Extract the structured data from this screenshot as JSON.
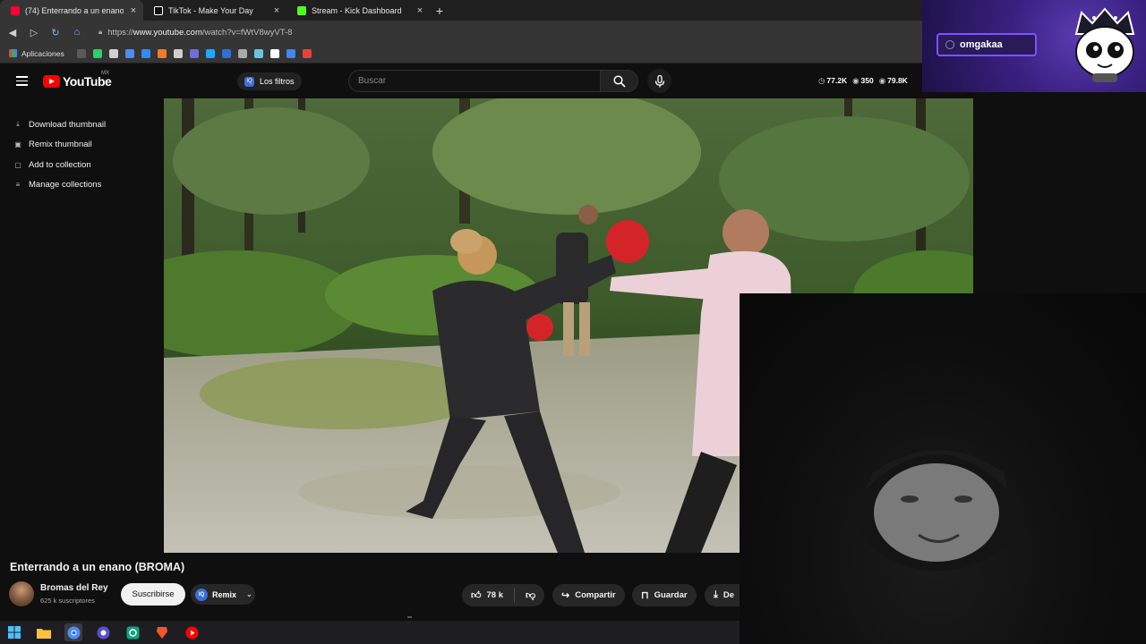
{
  "browser": {
    "tabs": [
      {
        "title": "(74) Enterrando a un enano",
        "favicon_color": "#ff0033",
        "active": true
      },
      {
        "title": "TikTok - Make Your Day",
        "favicon_color": "#ffffff",
        "active": false
      },
      {
        "title": "Stream - Kick Dashboard",
        "favicon_color": "#53fc18",
        "active": false
      }
    ],
    "new_tab_glyph": "+",
    "url_prefix": "https://",
    "url_host": "www.youtube.com",
    "url_path": "/watch?v=fWtV8wyVT-8",
    "bookmarks_label": "Aplicaciones",
    "bookmark_icon_colors": [
      "#5a5a5a",
      "#25d366",
      "#d0d0d0",
      "#4a8df6",
      "#2d8cff",
      "#f07b2a",
      "#cfcfcf",
      "#6f6fd8",
      "#1ea7fd",
      "#2f6fd6",
      "#aaaaaa",
      "#6bc3e0",
      "#ffffff",
      "#4285f4",
      "#ea4335"
    ]
  },
  "overlay": {
    "username": "omgakaa"
  },
  "youtube": {
    "logo_text": "YouTube",
    "region": "MX",
    "filters_badge": "IQ",
    "filters_label": "Los filtros",
    "search_placeholder": "Buscar",
    "stats": [
      {
        "icon": "◷",
        "value": "77.2K"
      },
      {
        "icon": "◉",
        "value": "350"
      },
      {
        "icon": "◉",
        "value": "79.8K"
      }
    ],
    "side_menu": [
      {
        "icon": "⤓",
        "label": "Download thumbnail"
      },
      {
        "icon": "▣",
        "label": "Remix thumbnail"
      },
      {
        "icon": "▢",
        "label": "Add to collection"
      },
      {
        "icon": "≡",
        "label": "Manage collections"
      }
    ],
    "video_title": "Enterrando a un enano (BROMA)",
    "channel_name": "Bromas del Rey",
    "channel_subs": "625 k suscriptores",
    "subscribe_label": "Suscribirse",
    "remix_badge": "IQ",
    "remix_label": "Remix",
    "like_count": "78 k",
    "share_label": "Compartir",
    "save_label": "Guardar",
    "download_label": "De"
  },
  "colors": {
    "youtube_red": "#ff0000",
    "overlay_accent": "#7b53ff",
    "page_bg": "#0f0f0f"
  }
}
